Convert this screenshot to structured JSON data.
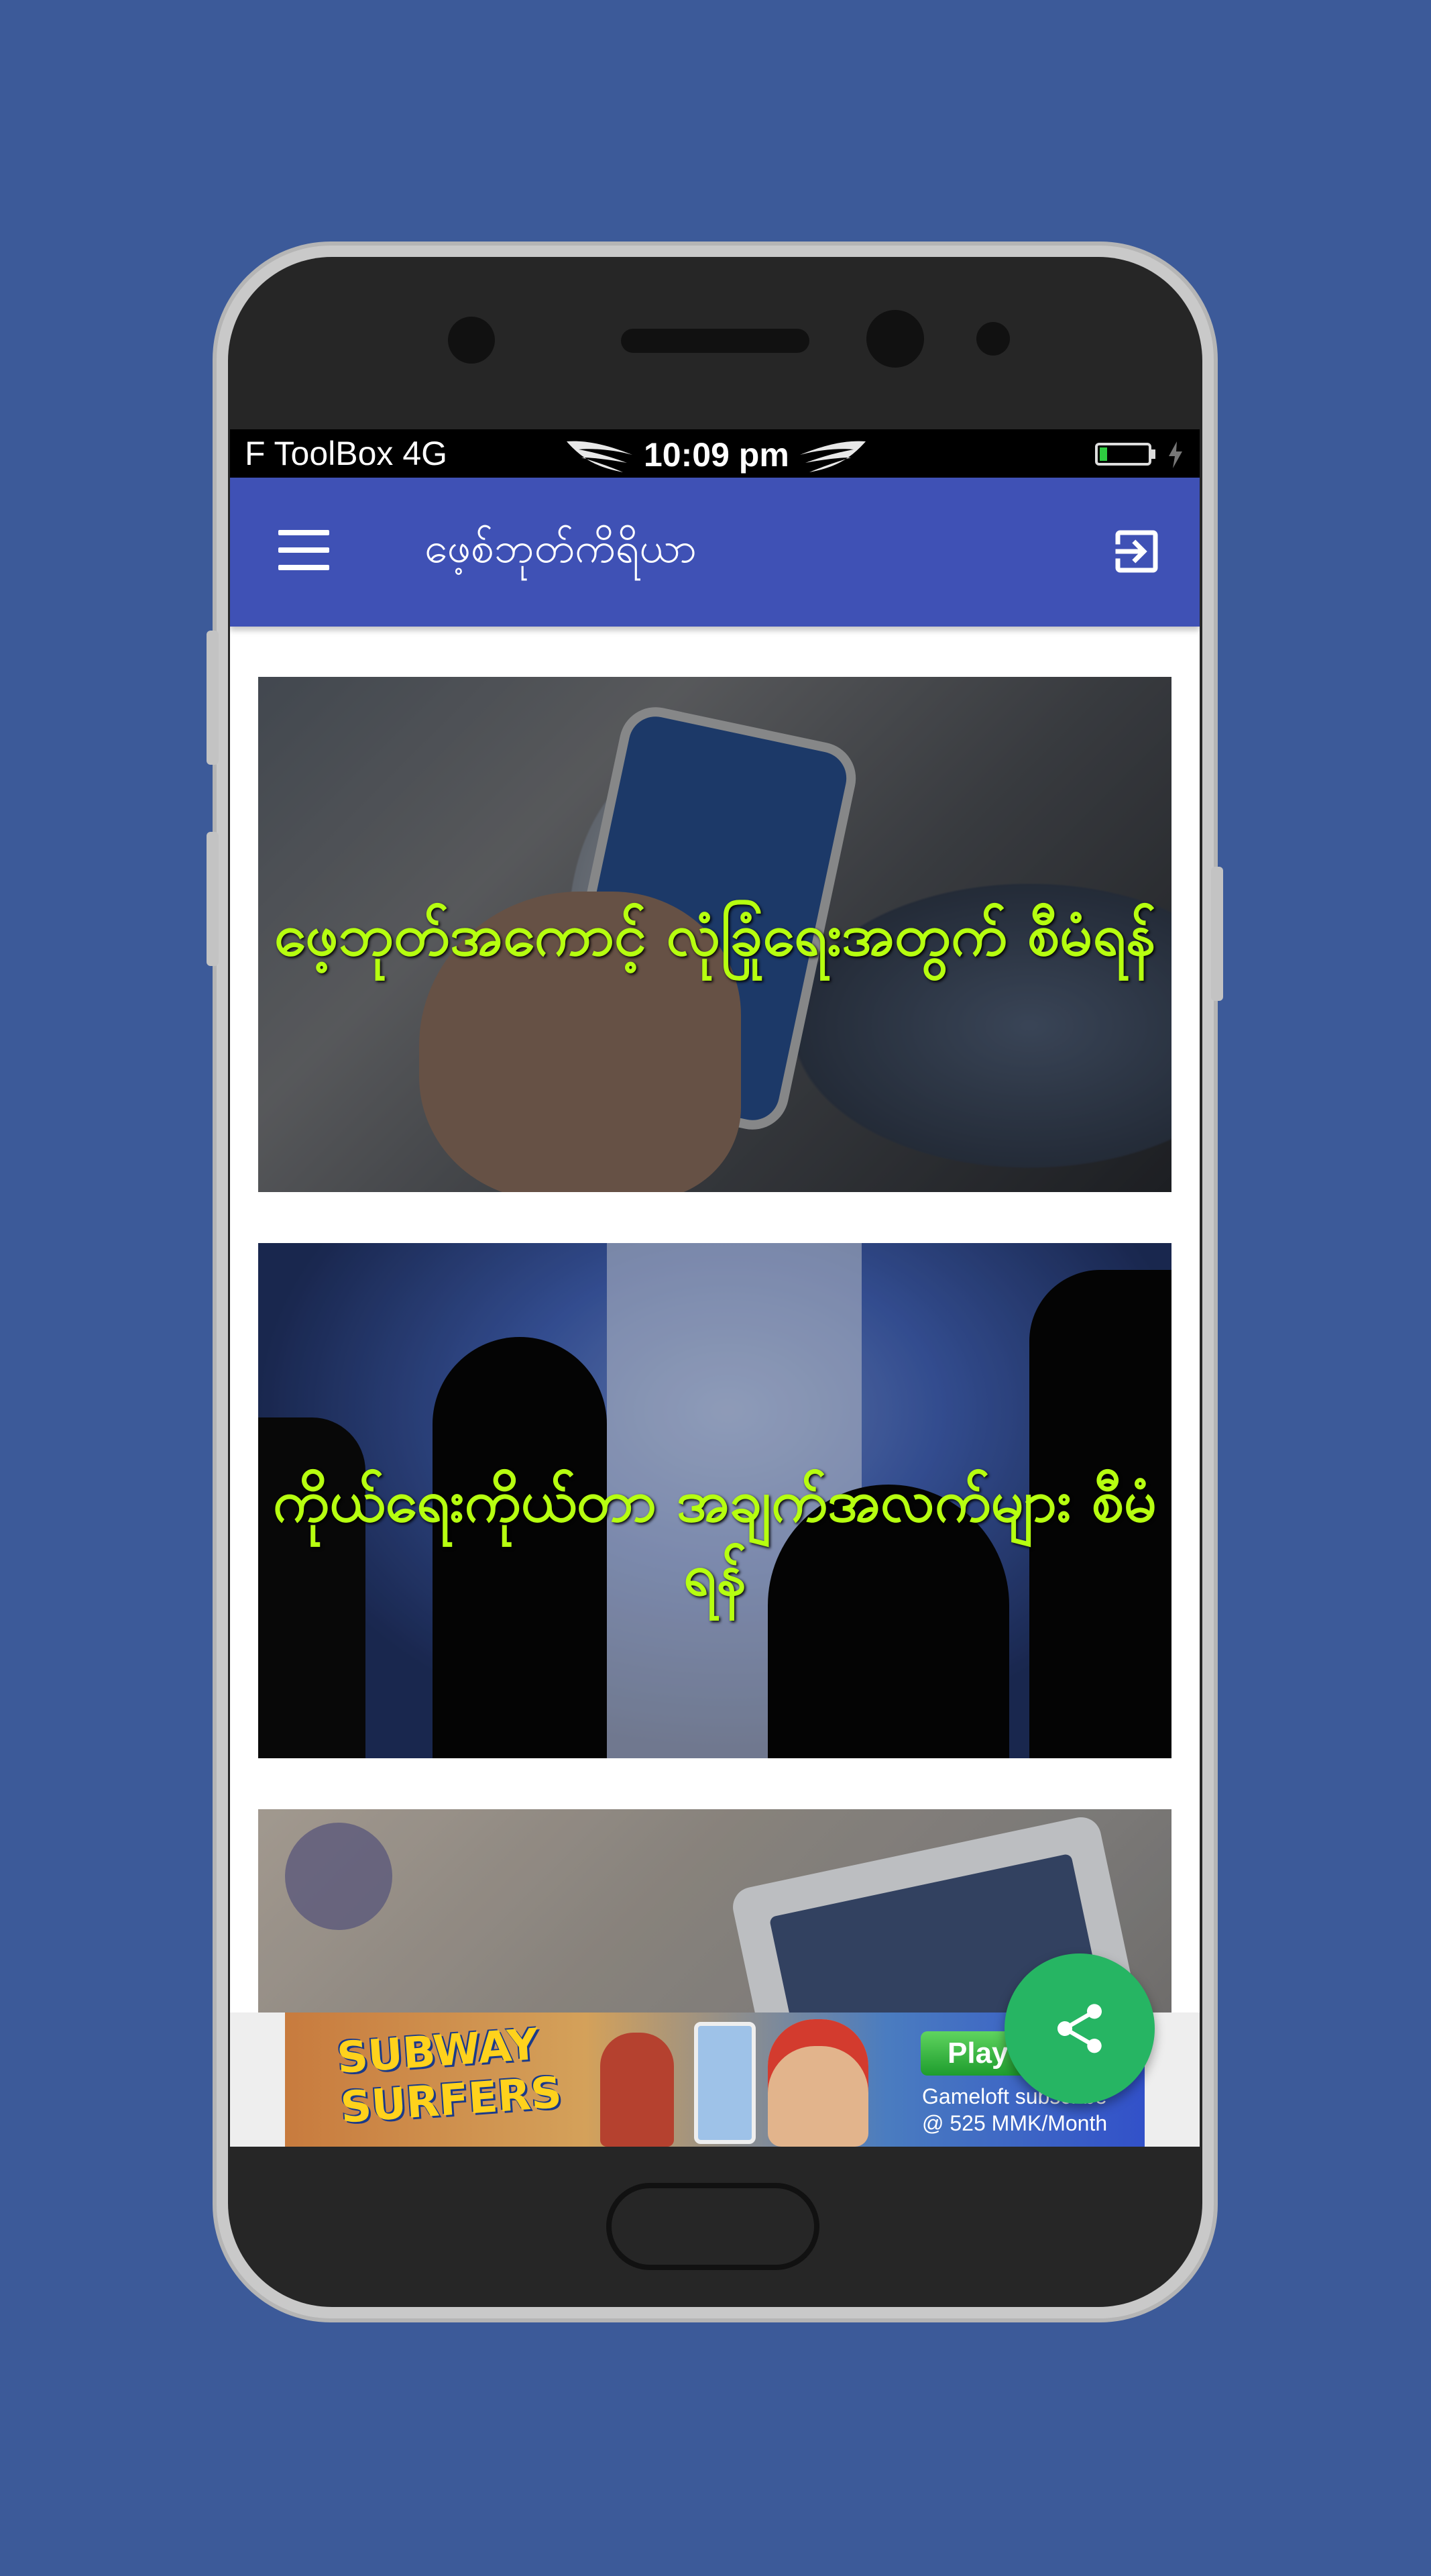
{
  "status_bar": {
    "carrier": "F ToolBox",
    "network": "4G",
    "time": "10:09 pm",
    "battery_level": 0.15
  },
  "app_bar": {
    "title": "ဖေ့စ်ဘုတ်ကိရိယာ"
  },
  "cards": [
    {
      "title": "ဖေ့ဘုတ်အကောင့် လုံခြုံရေးအတွက် စီမံရန်"
    },
    {
      "title": "ကိုယ်ရေးကိုယ်တာ အချက်အလက်များ စီမံရန်"
    },
    {
      "title": ""
    }
  ],
  "ad": {
    "logo_text": "SUBWAY SURFERS",
    "cta": "Play",
    "line1": "Gameloft subscribe",
    "line2": "@ 525 MMK/Month"
  },
  "icons": {
    "menu": "hamburger-menu-icon",
    "exit": "exit-to-app-icon",
    "share": "share-icon"
  },
  "colors": {
    "background": "#3c5a99",
    "app_bar": "#3f51b5",
    "card_title": "#b6ff10",
    "fab": "#26b563"
  }
}
